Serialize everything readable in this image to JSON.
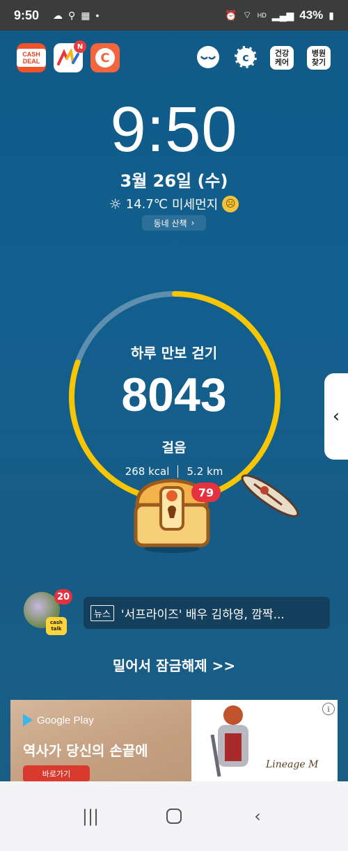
{
  "status_bar": {
    "time": "9:50",
    "battery": "43%",
    "icons": [
      "cloud-icon",
      "puzzle-icon",
      "calendar-icon",
      "dot-icon",
      "alarm-icon",
      "wifi-icon",
      "hd-voice-icon",
      "signal-icon",
      "battery-icon"
    ]
  },
  "apps": {
    "cashdeal_label": "CASH DEAL",
    "ns_badge": "N",
    "cashwalk_letter": "C"
  },
  "tools": {
    "health_care": "건강 케어",
    "hospital_find": "병원 찾기"
  },
  "clock": {
    "time": "9:50",
    "date": "3월 26일 (수)",
    "temperature": "14.7℃",
    "dust": "미세먼지",
    "walk_label": "동네 산책"
  },
  "steps": {
    "title": "하루 만보 걷기",
    "count": "8043",
    "unit": "걸음",
    "kcal": "268 kcal",
    "distance": "5.2 km",
    "progress": 0.8043,
    "reward_badge": "79"
  },
  "cashtalk": {
    "badge": "20",
    "logo": "cash talk"
  },
  "news": {
    "tag": "뉴스",
    "headline": "'서프라이즈' 배우 김하영, 깜짝..."
  },
  "unlock": {
    "label": "밀어서 잠금해제 >>"
  },
  "ad": {
    "store": "Google Play",
    "title": "역사가 당신의 손끝에",
    "button": "바로가기",
    "logo": "Lineage M"
  },
  "colors": {
    "background": "#135d8b",
    "ring_track": "#5e8fae",
    "ring_progress": "#f7c600",
    "badge_red": "#e6323f"
  }
}
